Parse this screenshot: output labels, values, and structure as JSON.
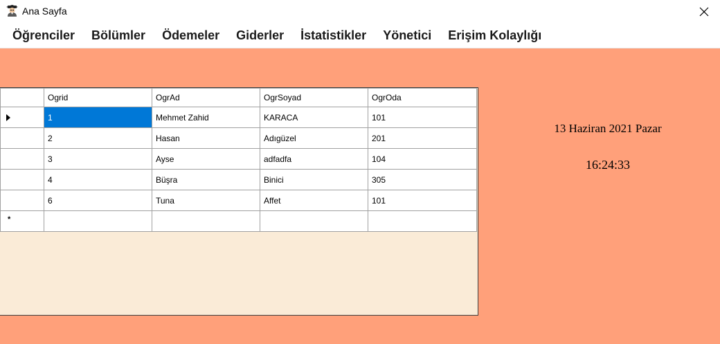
{
  "window": {
    "title": "Ana Sayfa",
    "icon": "student-avatar-icon",
    "close_icon": "close-icon",
    "background_color": "#ffa07a"
  },
  "menu": {
    "items": [
      "Öğrenciler",
      "Bölümler",
      "Ödemeler",
      "Giderler",
      "İstatistikler",
      "Yönetici",
      "Erişim Kolaylığı"
    ]
  },
  "grid": {
    "background_color": "#faebd7",
    "selection_color": "#0078d7",
    "columns": [
      "Ogrid",
      "OgrAd",
      "OgrSoyad",
      "OgrOda"
    ],
    "rows": [
      [
        "1",
        "Mehmet Zahid",
        "KARACA",
        "101"
      ],
      [
        "2",
        "Hasan",
        "Adıgüzel",
        "201"
      ],
      [
        "3",
        "Ayse",
        "adfadfa",
        "104"
      ],
      [
        "4",
        "Büşra",
        "Binici",
        "305"
      ],
      [
        "6",
        "Tuna",
        "Affet",
        "101"
      ]
    ],
    "new_row_marker": "*"
  },
  "clock": {
    "date": "13 Haziran 2021 Pazar",
    "time": "16:24:33"
  }
}
